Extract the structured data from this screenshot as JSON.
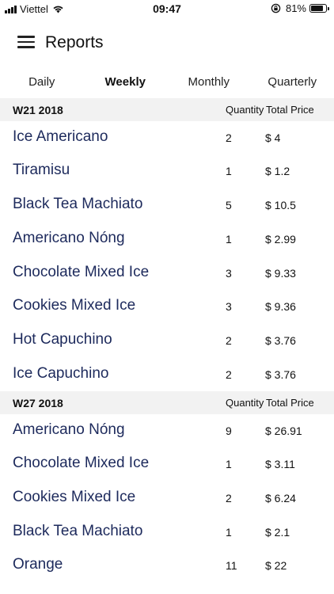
{
  "status_bar": {
    "carrier": "Viettel",
    "time": "09:47",
    "battery_percent": "81%",
    "battery_level": 0.81
  },
  "app_bar": {
    "title": "Reports",
    "menu_icon": "hamburger-menu-icon"
  },
  "tabs": [
    {
      "label": "Daily",
      "active": false
    },
    {
      "label": "Weekly",
      "active": true
    },
    {
      "label": "Monthly",
      "active": false
    },
    {
      "label": "Quarterly",
      "active": false
    }
  ],
  "sections": [
    {
      "title": "W21 2018",
      "qty_header": "Quantity",
      "total_header": "Total Price",
      "items": [
        {
          "name": "Ice Americano",
          "qty": "2",
          "price": "$ 4"
        },
        {
          "name": "Tiramisu",
          "qty": "1",
          "price": "$ 1.2"
        },
        {
          "name": "Black Tea Machiato",
          "qty": "5",
          "price": "$ 10.5"
        },
        {
          "name": "Americano Nóng",
          "qty": "1",
          "price": "$ 2.99"
        },
        {
          "name": "Chocolate Mixed Ice",
          "qty": "3",
          "price": "$ 9.33"
        },
        {
          "name": "Cookies Mixed Ice",
          "qty": "3",
          "price": "$ 9.36"
        },
        {
          "name": "Hot Capuchino",
          "qty": "2",
          "price": "$ 3.76"
        },
        {
          "name": "Ice Capuchino",
          "qty": "2",
          "price": "$ 3.76"
        }
      ]
    },
    {
      "title": "W27 2018",
      "qty_header": "Quantity",
      "total_header": "Total Price",
      "items": [
        {
          "name": "Americano Nóng",
          "qty": "9",
          "price": "$ 26.91"
        },
        {
          "name": "Chocolate Mixed Ice",
          "qty": "1",
          "price": "$ 3.11"
        },
        {
          "name": "Cookies Mixed Ice",
          "qty": "2",
          "price": "$ 6.24"
        },
        {
          "name": "Black Tea Machiato",
          "qty": "1",
          "price": "$ 2.1"
        },
        {
          "name": "Orange",
          "qty": "11",
          "price": "$ 22"
        }
      ]
    }
  ],
  "colors": {
    "item_text": "#1d2a5c",
    "section_bg": "#f2f2f2"
  }
}
